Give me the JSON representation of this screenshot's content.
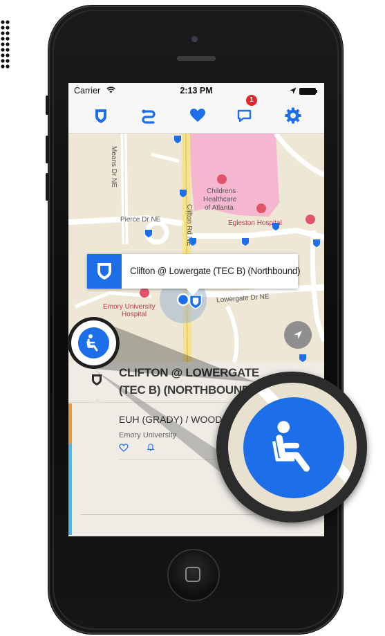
{
  "status_bar": {
    "carrier": "Carrier",
    "time": "2:13 PM"
  },
  "toolbar": {
    "icons": [
      "shield-icon",
      "route-icon",
      "heart-icon",
      "message-icon",
      "gear-icon"
    ],
    "message_badge": "1",
    "accent_color": "#1c6fe8"
  },
  "map": {
    "labels": {
      "means_dr": "Means Dr NE",
      "childrens_healthcare": [
        "Childrens",
        "Healthcare",
        "of Atlanta"
      ],
      "egleston": "Egleston Hospital",
      "pierce_dr": "Pierce Dr NE",
      "clifton_rd": "Clifton Rd NE",
      "emory_hospital": [
        "Emory University",
        "Hospital"
      ],
      "lowergate_dr": "Lowergate Dr NE"
    },
    "callout": {
      "stop_name": "Clifton @ Lowergate (TEC B) (Northbound)"
    }
  },
  "panel": {
    "stop_title_line1": "CLIFTON @ LOWERGATE",
    "stop_title_line2": "(TEC B) (NORTHBOUND)",
    "route_name": "EUH (GRADY) / WOODRUFF",
    "route_subtitle": "Emory University"
  },
  "accessibility": {
    "icon": "wheelchair-accessible-icon"
  }
}
